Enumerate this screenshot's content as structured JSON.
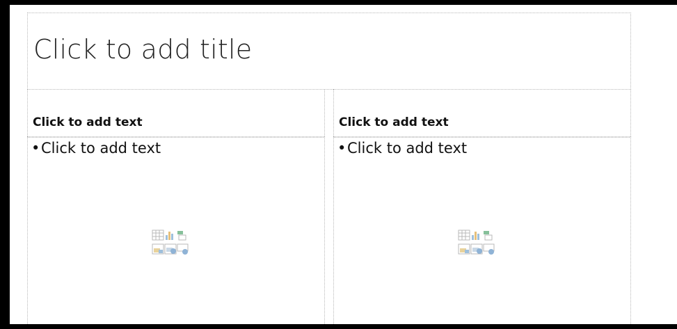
{
  "slide": {
    "title_placeholder": "Click to add title",
    "left": {
      "heading_placeholder": "Click to add text",
      "bullet_placeholder": "Click to add text"
    },
    "right": {
      "heading_placeholder": "Click to add text",
      "bullet_placeholder": "Click to add text"
    },
    "content_icons": [
      "insert-table-icon",
      "insert-chart-icon",
      "insert-smartart-icon",
      "insert-picture-icon",
      "insert-online-picture-icon",
      "insert-video-icon"
    ]
  }
}
